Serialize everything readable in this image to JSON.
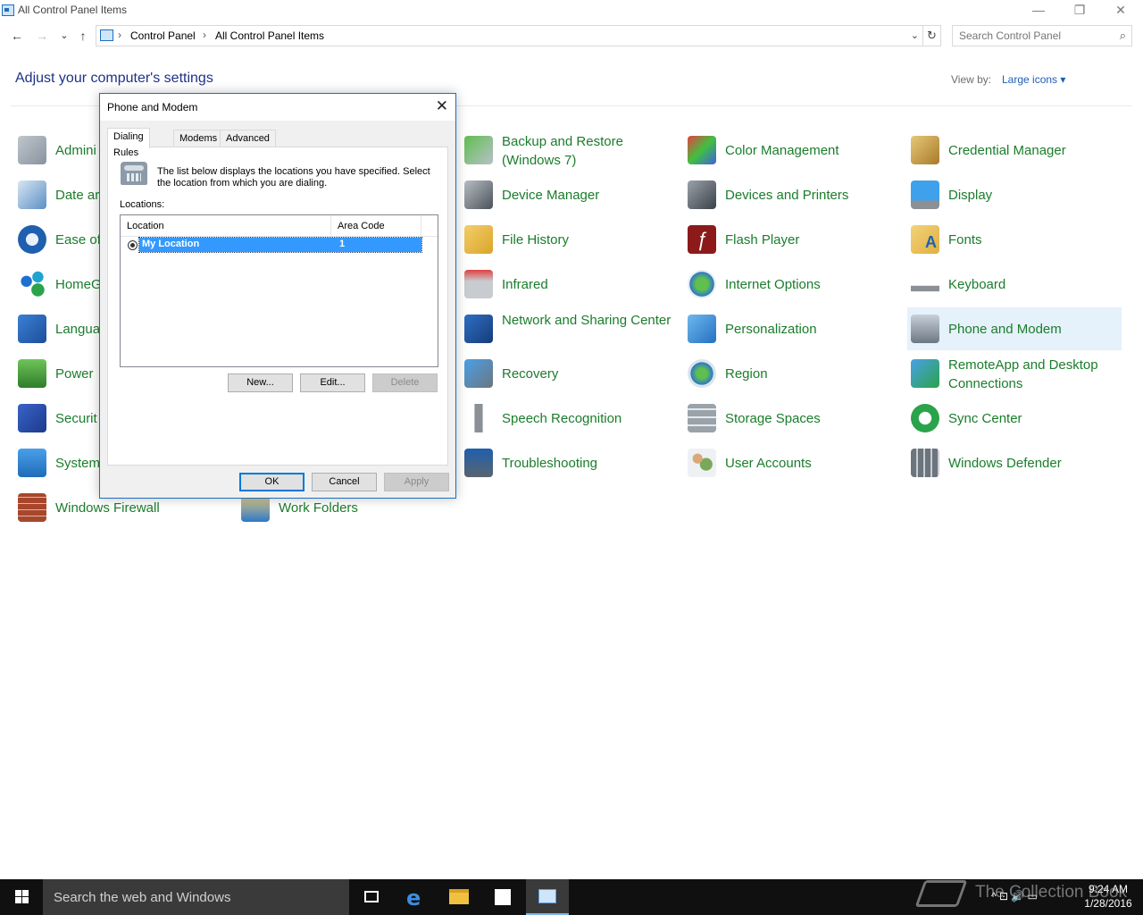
{
  "window": {
    "title": "All Control Panel Items",
    "minimize": "—",
    "maximize": "❐",
    "close": "✕"
  },
  "nav": {
    "back": "←",
    "forward": "→",
    "recent": "⌄",
    "up": "↑",
    "breadcrumb": [
      "Control Panel",
      "All Control Panel Items"
    ],
    "crumb_sep": "›",
    "dropdown": "⌄",
    "refresh": "↻",
    "search_placeholder": "Search Control Panel",
    "search_icon": "⌕"
  },
  "header": {
    "title": "Adjust your computer's settings",
    "view_by_label": "View by:",
    "view_by_value": "Large icons ▾"
  },
  "items": {
    "c0": [
      "Admini",
      "Date ar",
      "Ease of",
      "HomeG",
      "Langua",
      "Power",
      "Securit",
      "System",
      "Windows Firewall"
    ],
    "c1": [
      "Work Folders"
    ],
    "c2": [
      "Backup and Restore (Windows 7)",
      "Device Manager",
      "File History",
      "Infrared",
      "Network and Sharing Center",
      "Recovery",
      "Speech Recognition",
      "Troubleshooting"
    ],
    "c3": [
      "Color Management",
      "Devices and Printers",
      "Flash Player",
      "Internet Options",
      "Personalization",
      "Region",
      "Storage Spaces",
      "User Accounts"
    ],
    "c4": [
      "Credential Manager",
      "Display",
      "Fonts",
      "Keyboard",
      "Phone and Modem",
      "RemoteApp and Desktop Connections",
      "Sync Center",
      "Windows Defender"
    ]
  },
  "dialog": {
    "title": "Phone and Modem",
    "close": "✕",
    "tabs": [
      "Dialing Rules",
      "Modems",
      "Advanced"
    ],
    "description": "The list below displays the locations you have specified. Select the location from which you are dialing.",
    "locations_label": "Locations:",
    "columns": [
      "Location",
      "Area Code"
    ],
    "rows": [
      {
        "location": "My Location",
        "area_code": "1"
      }
    ],
    "buttons": {
      "new": "New...",
      "edit": "Edit...",
      "delete": "Delete",
      "ok": "OK",
      "cancel": "Cancel",
      "apply": "Apply"
    }
  },
  "taskbar": {
    "search_placeholder": "Search the web and Windows",
    "tray_icons": "^ ⊡ 🔊 ▭",
    "time": "9:24 AM",
    "date": "1/28/2016",
    "watermark": "The Collection Book"
  },
  "colors": {
    "link_green": "#1a7d2b",
    "heading_blue": "#1e3287",
    "selection_blue": "#3399ff",
    "highlight": "#e5f1fb"
  }
}
